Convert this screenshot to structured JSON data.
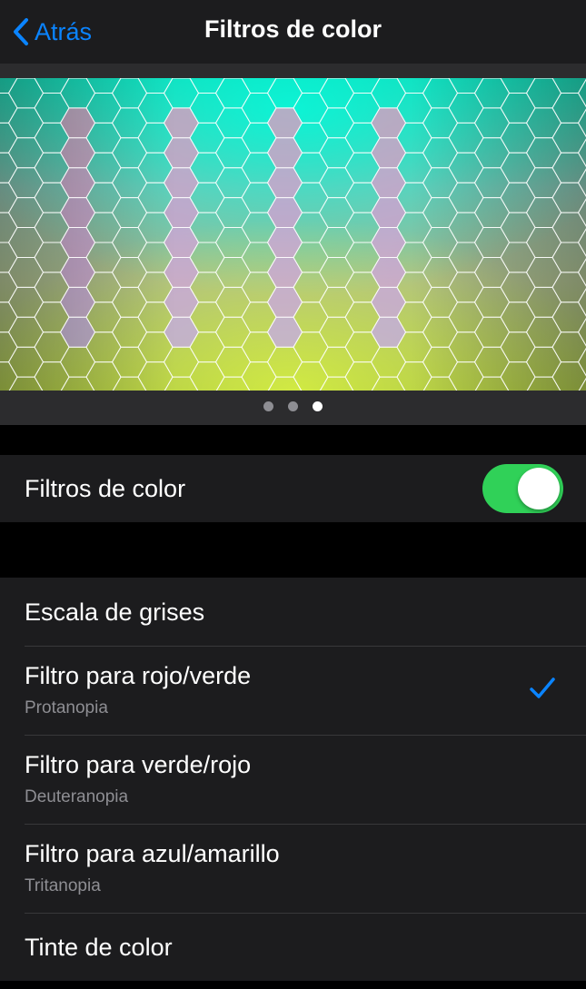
{
  "nav": {
    "back_label": "Atrás",
    "title": "Filtros de color",
    "accent_color": "#0a84ff"
  },
  "preview": {
    "page_count": 3,
    "active_page_index": 2
  },
  "color_filters_toggle": {
    "label": "Filtros de color",
    "on": true,
    "on_color": "#30d158"
  },
  "filter_options": [
    {
      "title": "Escala de grises",
      "subtitle": "",
      "selected": false
    },
    {
      "title": "Filtro para rojo/verde",
      "subtitle": "Protanopia",
      "selected": true
    },
    {
      "title": "Filtro para verde/rojo",
      "subtitle": "Deuteranopia",
      "selected": false
    },
    {
      "title": "Filtro para azul/amarillo",
      "subtitle": "Tritanopia",
      "selected": false
    },
    {
      "title": "Tinte de color",
      "subtitle": "",
      "selected": false
    }
  ]
}
